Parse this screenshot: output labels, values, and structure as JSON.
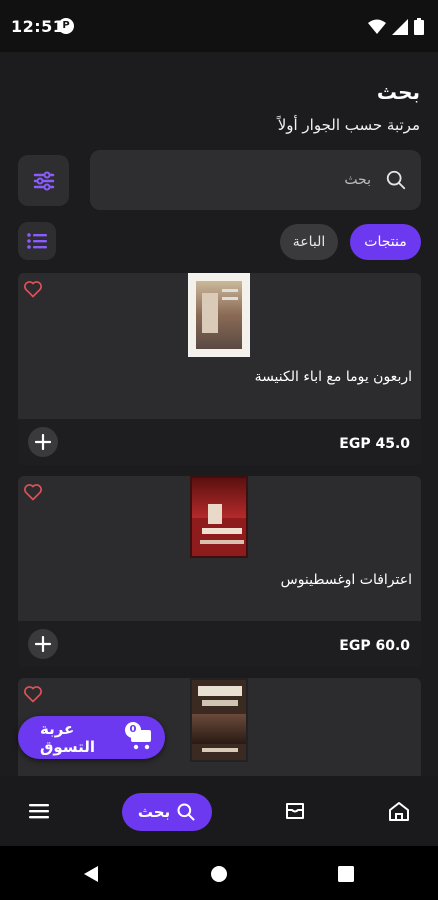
{
  "status_bar": {
    "time": "12:51",
    "app_indicator": "P",
    "icons": [
      "wifi-icon",
      "signal-icon",
      "battery-icon"
    ]
  },
  "header": {
    "title": "بحث",
    "subtitle": "مرتبة حسب الجوار أولاً"
  },
  "search": {
    "placeholder": "بحث",
    "value": ""
  },
  "tabs": [
    {
      "label": "منتجات",
      "active": true
    },
    {
      "label": "الباعة",
      "active": false
    }
  ],
  "products": [
    {
      "title": "اربعون يوما مع اباء الكنيسة",
      "price": "EGP 45.0"
    },
    {
      "title": "اعترافات اوغسطينوس",
      "price": "EGP 60.0"
    },
    {
      "title": "",
      "price": ""
    }
  ],
  "cart": {
    "label": "عربة التسوق",
    "count": "0"
  },
  "bottom_nav": {
    "search_label": "بحث",
    "items": [
      "menu-icon",
      "search-icon",
      "store-icon",
      "home-icon"
    ]
  },
  "colors": {
    "accent": "#6d39f0",
    "background": "#1c1c1e",
    "card": "#2c2c2e",
    "heart": "#e0505a"
  }
}
